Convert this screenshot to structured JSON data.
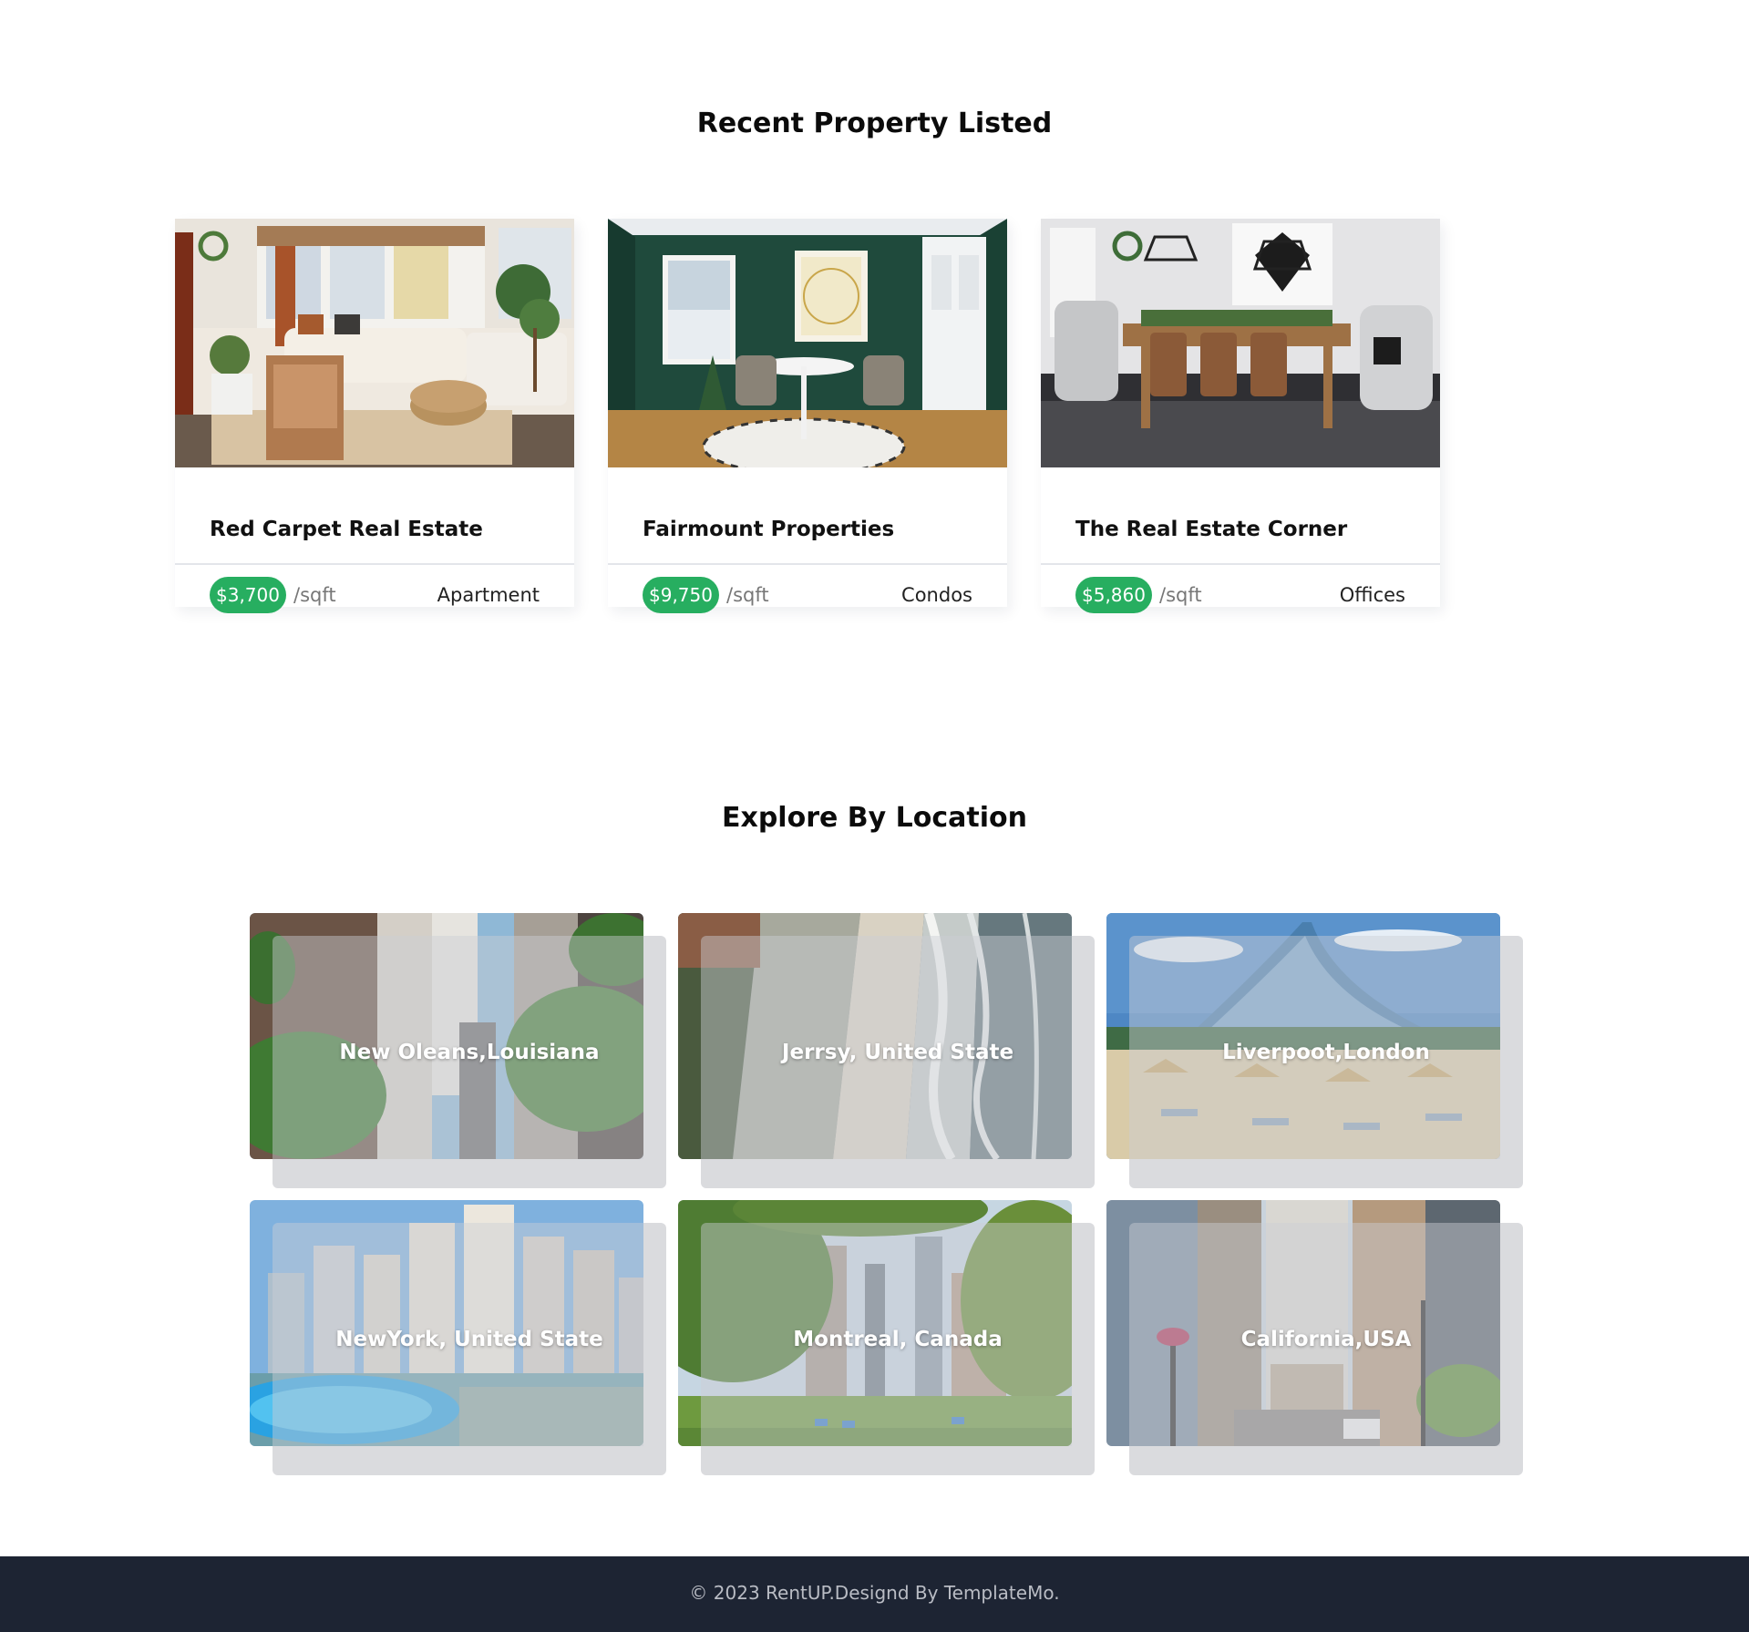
{
  "recent": {
    "title": "Recent Property Listed",
    "properties": [
      {
        "name": "Red Carpet Real Estate",
        "price": "$3,700",
        "unit": "/sqft",
        "type": "Apartment",
        "image": "living-room-photo"
      },
      {
        "name": "Fairmount Properties",
        "price": "$9,750",
        "unit": "/sqft",
        "type": "Condos",
        "image": "green-dining-room-photo"
      },
      {
        "name": "The Real Estate Corner",
        "price": "$5,860",
        "unit": "/sqft",
        "type": "Offices",
        "image": "dining-table-photo"
      }
    ]
  },
  "explore": {
    "title": "Explore By Location",
    "locations": [
      {
        "label": "New Oleans,Louisiana",
        "image": "city-street-photo"
      },
      {
        "label": "Jerrsy, United State",
        "image": "beach-aerial-photo"
      },
      {
        "label": "Liverpoot,London",
        "image": "beach-resort-photo"
      },
      {
        "label": "NewYork, United State",
        "image": "skyline-marina-photo"
      },
      {
        "label": "Montreal, Canada",
        "image": "city-park-photo"
      },
      {
        "label": "California,USA",
        "image": "downtown-avenue-photo"
      }
    ]
  },
  "footer": {
    "text": "© 2023 RentUP.Designd By TemplateMo."
  },
  "colors": {
    "price_badge": "#27ae60",
    "footer_bg": "#1d2433",
    "footer_text": "#b9bcc4"
  }
}
